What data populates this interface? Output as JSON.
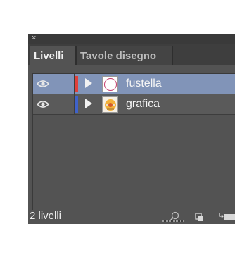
{
  "panel": {
    "close_label": "×",
    "tabs": [
      {
        "label": "Livelli",
        "active": true
      },
      {
        "label": "Tavole disegno",
        "active": false
      }
    ],
    "layers": [
      {
        "name": "fustella",
        "color": "#e0403a",
        "selected": true,
        "visible": true,
        "thumbnail": "circle-outline"
      },
      {
        "name": "grafica",
        "color": "#3f62c9",
        "selected": false,
        "visible": true,
        "thumbnail": "label-artwork"
      }
    ],
    "status": {
      "count_label": "2 livelli"
    },
    "buttons": [
      "locate-object-icon",
      "make-clipping-mask-icon",
      "create-sublayer-icon"
    ]
  }
}
